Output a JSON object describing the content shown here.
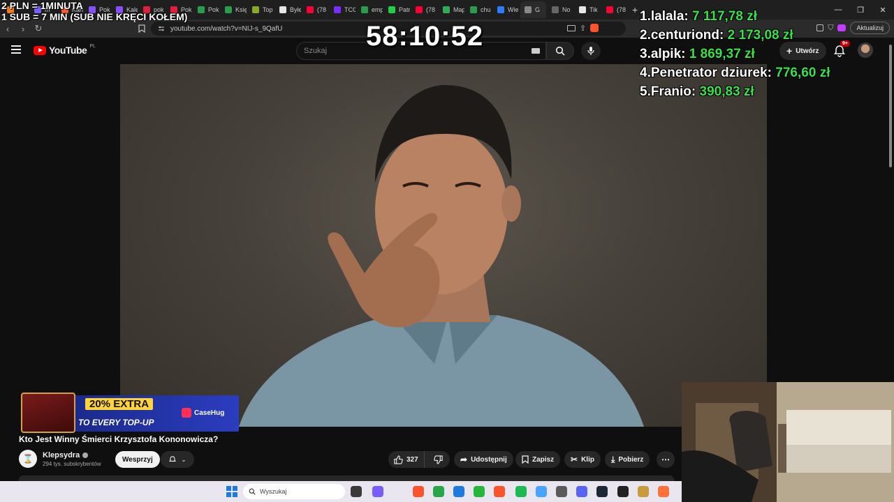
{
  "browser": {
    "tabs": [
      {
        "label": "",
        "color": "#ff7a1a"
      },
      {
        "label": "m",
        "color": "#7b5cff"
      },
      {
        "label": "Kart",
        "color": "#ff5a2a"
      },
      {
        "label": "Pok",
        "color": "#8a4dff"
      },
      {
        "label": "Kale",
        "color": "#8a4dff"
      },
      {
        "label": "pok",
        "color": "#e0203a"
      },
      {
        "label": "Pok",
        "color": "#e0203a"
      },
      {
        "label": "Pok",
        "color": "#2a9d4a"
      },
      {
        "label": "Księ",
        "color": "#2a9d4a"
      },
      {
        "label": "Top",
        "color": "#88aa22"
      },
      {
        "label": "Byłe",
        "color": "#e6e6e6"
      },
      {
        "label": "(78",
        "color": "#ff0033"
      },
      {
        "label": "TCG",
        "color": "#7b2dff"
      },
      {
        "label": "emp",
        "color": "#2a9d4a"
      },
      {
        "label": "Patr",
        "color": "#22cc44"
      },
      {
        "label": "(78",
        "color": "#ff0033"
      },
      {
        "label": "Map",
        "color": "#33aa55"
      },
      {
        "label": "chu",
        "color": "#2a9d4a"
      },
      {
        "label": "Wie",
        "color": "#2a7dff"
      },
      {
        "label": "G",
        "color": "#888888",
        "active": true
      },
      {
        "label": "No",
        "color": "#666666"
      },
      {
        "label": "Tik",
        "color": "#e6e6e6"
      },
      {
        "label": "(78",
        "color": "#ff0033"
      }
    ],
    "url": "youtube.com/watch?v=NIJ-s_9QafU",
    "update_button": "Aktualizuj"
  },
  "youtube": {
    "logo_text": "YouTube",
    "region": "PL",
    "search_placeholder": "Szukaj",
    "create_label": "Utwórz",
    "notif_badge": "9+"
  },
  "overlay": {
    "rules_line1": "2 PLN = 1MINUTA",
    "rules_line2": "1 SUB = 7 MIN (SUB NIE KRĘCI KOŁEM)",
    "timer": "58:10:52",
    "leaderboard": [
      {
        "rank": "1.",
        "name": "lalala:",
        "amount": "7 117,78 zł"
      },
      {
        "rank": "2.",
        "name": "centuriond:",
        "amount": "2 173,08 zł"
      },
      {
        "rank": "3.",
        "name": "alpik:",
        "amount": "1 869,37 zł"
      },
      {
        "rank": "4.",
        "name": "Penetrator dziurek:",
        "amount": "776,60 zł"
      },
      {
        "rank": "5.",
        "name": "Franio:",
        "amount": "390,83 zł"
      }
    ]
  },
  "ad": {
    "line1": "20% EXTRA",
    "line2": "TO EVERY TOP-UP",
    "brand": "CaseHug"
  },
  "video": {
    "title": "Kto Jest Winny Śmierci Krzysztofa Kononowicza?",
    "channel": "Klepsydra",
    "subscribers": "294 tys. subskrybentów",
    "support_label": "Wesprzyj",
    "likes": "327",
    "share_label": "Udostępnij",
    "save_label": "Zapisz",
    "clip_label": "Klip",
    "download_label": "Pobierz"
  },
  "taskbar": {
    "search_placeholder": "Wyszukaj"
  }
}
